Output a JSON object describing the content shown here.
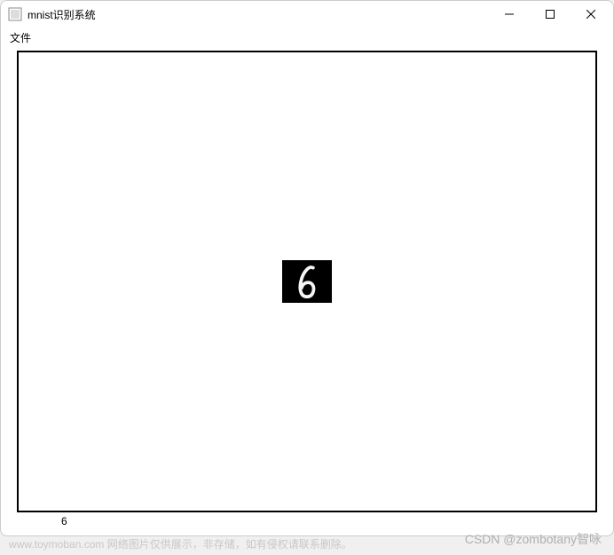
{
  "window": {
    "title": "mnist识别系统"
  },
  "menubar": {
    "file_label": "文件"
  },
  "image": {
    "digit_depicted": "6"
  },
  "result": {
    "prediction": "6"
  },
  "watermarks": {
    "left": "www.toymoban.com 网络图片仅供展示，非存储，如有侵权请联系删除。",
    "right": "CSDN @zombotany智咏"
  }
}
